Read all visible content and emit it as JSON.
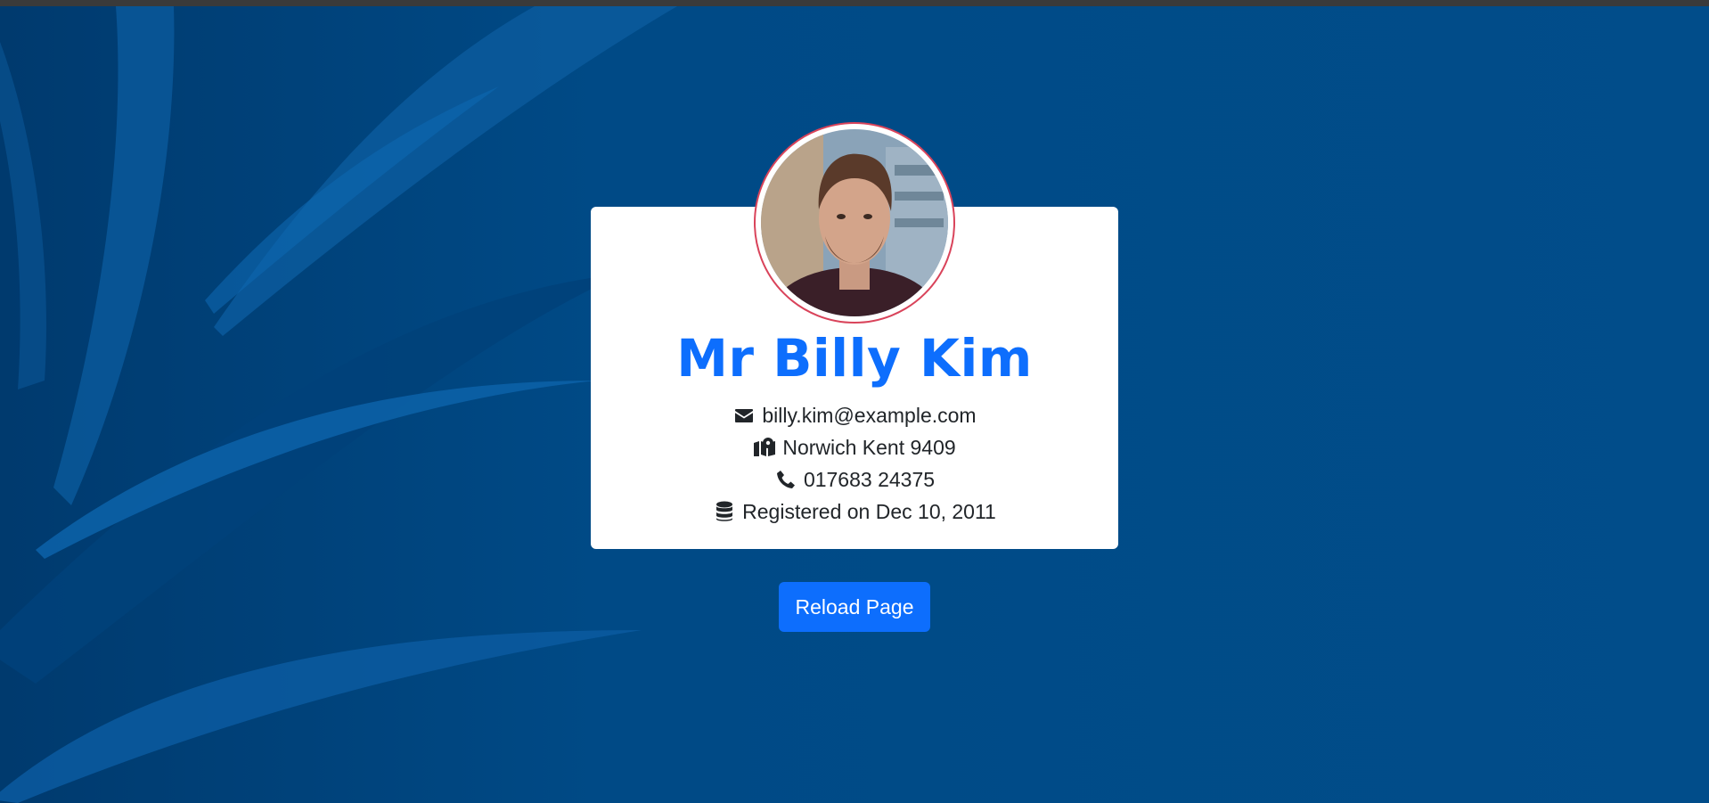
{
  "theme": {
    "background": "#014d8a",
    "accent": "#0d6efd",
    "avatar_border": "#d9435a"
  },
  "profile": {
    "name": "Mr Billy Kim",
    "avatar_icon": "user-photo",
    "email": "billy.kim@example.com",
    "email_icon": "envelope-icon",
    "location": "Norwich Kent 9409",
    "location_icon": "map-location-icon",
    "phone": "017683 24375",
    "phone_icon": "phone-icon",
    "registered": "Registered on Dec 10, 2011",
    "registered_icon": "database-icon"
  },
  "actions": {
    "reload_label": "Reload Page"
  }
}
